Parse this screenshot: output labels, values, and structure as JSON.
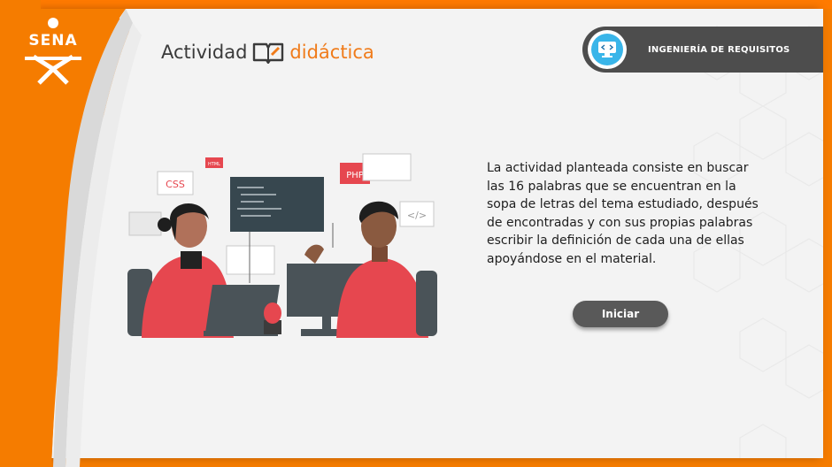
{
  "brand": {
    "logo_text": "SENA"
  },
  "header": {
    "title_part1": "Actividad",
    "title_part2": "didáctica",
    "title_icon": "book-icon"
  },
  "badge": {
    "icon": "code-monitor-icon",
    "label": "INGENIERÍA DE REQUISITOS"
  },
  "illustration": {
    "tag_css": "CSS",
    "tag_php": "PHP",
    "tag_small": "HTML",
    "code_icon": "</>"
  },
  "content": {
    "description": "La actividad planteada consiste en buscar las 16 palabras que se encuentran en la sopa de letras del tema estudiado, después de encontradas y con sus propias palabras escribir la definición de cada una de ellas apoyándose en el material."
  },
  "actions": {
    "start_label": "Iniciar"
  },
  "colors": {
    "accent": "#f57c00",
    "badge": "#4d4d4d",
    "button": "#595959",
    "icon_blue": "#39b5e9"
  }
}
